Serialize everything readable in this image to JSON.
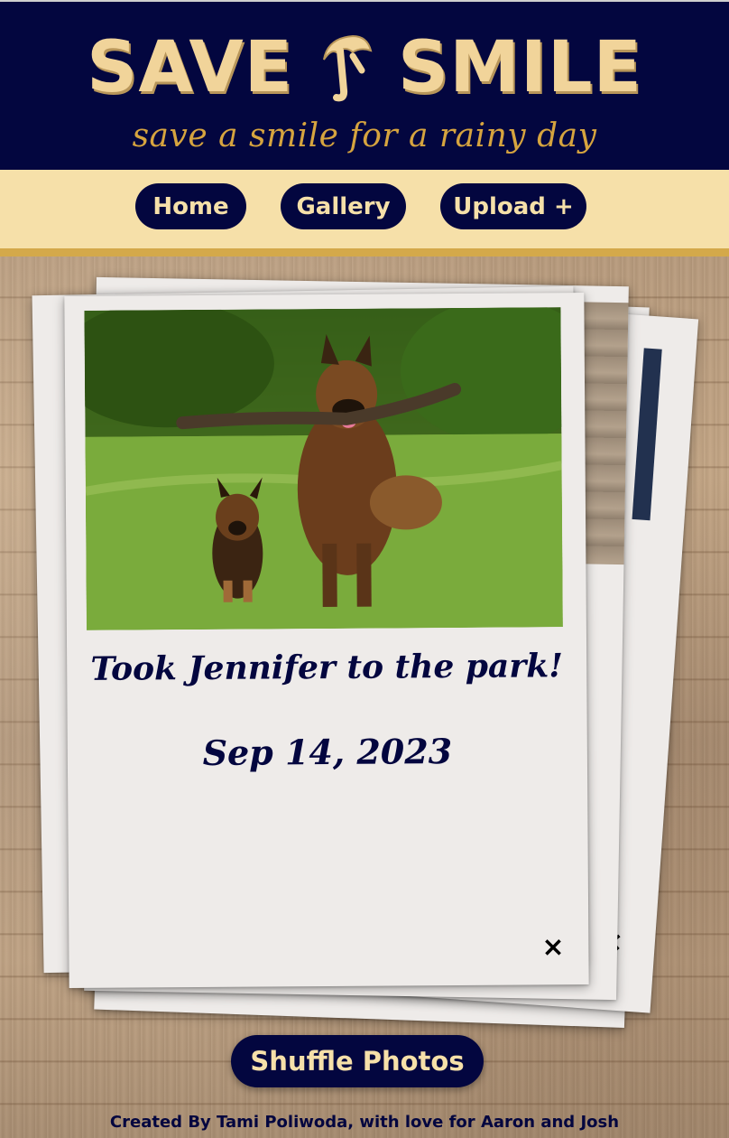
{
  "header": {
    "logo_left": "SAVE",
    "logo_right": "SMILE",
    "logo_mark": "umbrella-icon",
    "tagline": "save a smile for a rainy day"
  },
  "nav": {
    "items": [
      {
        "label": "Home"
      },
      {
        "label": "Gallery"
      },
      {
        "label": "Upload +"
      }
    ]
  },
  "polaroid": {
    "photo": "german-shepherd-and-puppy-with-stick",
    "caption": "Took Jennifer to the park!",
    "date": "Sep 14, 2023",
    "close_label": "×"
  },
  "back_polaroid": {
    "close_label": "×"
  },
  "shuffle": {
    "label": "Shuffle Photos"
  },
  "footer": {
    "credit": "Created By Tami Poliwoda, with love for Aaron and Josh"
  },
  "colors": {
    "navy": "#03063f",
    "cream": "#f6e0a9",
    "gold": "#d4a94a",
    "card": "#eeebe9"
  }
}
